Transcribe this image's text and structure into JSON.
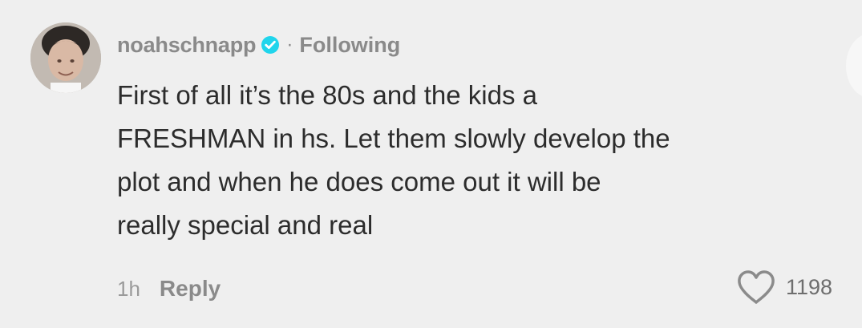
{
  "comment": {
    "username": "noahschnapp",
    "verified_icon": "verified-badge-icon",
    "separator": "·",
    "follow_status": "Following",
    "text_lines": [
      "First of all it’s the 80s and the kids a",
      "FRESHMAN in hs. Let them slowly develop the",
      "plot and when he does come out it will be",
      "really special and real"
    ],
    "time": "1h",
    "reply_label": "Reply",
    "like_icon": "heart-icon",
    "like_count": "1198"
  },
  "colors": {
    "background": "#efefef",
    "username": "#8a8a8a",
    "body_text": "#2c2c2c",
    "verified": "#20d5ec"
  }
}
